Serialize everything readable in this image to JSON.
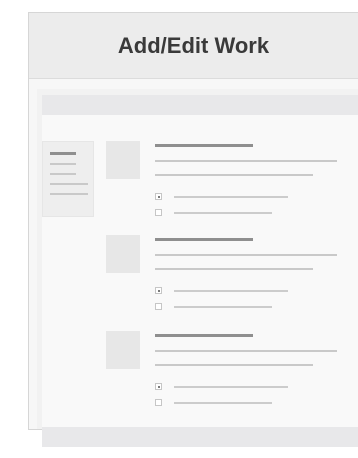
{
  "window": {
    "title": "Add/Edit Work"
  },
  "items": [
    {
      "first_checked": true,
      "second_checked": false
    },
    {
      "first_checked": true,
      "second_checked": false
    },
    {
      "first_checked": true,
      "second_checked": false
    }
  ]
}
